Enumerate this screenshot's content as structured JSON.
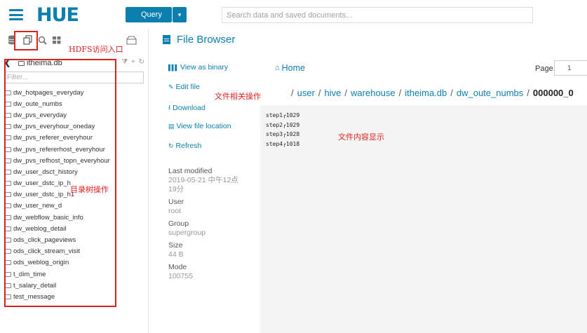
{
  "topbar": {
    "logo": "HUE",
    "query_label": "Query",
    "query_caret": "▾",
    "search_placeholder": "Search data and saved documents..."
  },
  "sidebar": {
    "annotation": "HDFS访问入口",
    "db_name": "itheima.db",
    "filter_placeholder": "Filter...",
    "tree_annotation": "目录树操作",
    "items": [
      "dw_hotpages_everyday",
      "dw_oute_numbs",
      "dw_pvs_everyday",
      "dw_pvs_everyhour_oneday",
      "dw_pvs_referer_everyhour",
      "dw_pvs_refererhost_everyhour",
      "dw_pvs_refhost_topn_everyhour",
      "dw_user_dsct_history",
      "dw_user_dstc_ip_h",
      "dw_user_dstc_ip_h1",
      "dw_user_new_d",
      "dw_webflow_basic_info",
      "dw_weblog_detail",
      "ods_click_pageviews",
      "ods_click_stream_visit",
      "ods_weblog_origin",
      "t_dim_time",
      "t_salary_detail",
      "test_message"
    ]
  },
  "file_browser": {
    "title": "File Browser",
    "actions": {
      "view_as_binary": "View as binary",
      "edit_file": "Edit file",
      "download": "Download",
      "view_file_location": "View file location",
      "refresh": "Refresh"
    },
    "actions_annotation": "文件相关操作",
    "meta": {
      "last_modified_label": "Last modified",
      "last_modified_value": "2019-05-21 中午12点19分",
      "user_label": "User",
      "user_value": "root",
      "group_label": "Group",
      "group_value": "supergroup",
      "size_label": "Size",
      "size_value": "44 B",
      "mode_label": "Mode",
      "mode_value": "100755"
    },
    "home_label": "Home",
    "page_label": "Page",
    "page_value": "1",
    "breadcrumb": [
      "user",
      "hive",
      "warehouse",
      "itheima.db",
      "dw_oute_numbs"
    ],
    "breadcrumb_last": "000000_0",
    "content_lines": [
      "step1\u00011029",
      "step2\u00011029",
      "step3\u00011028",
      "step4\u00011018"
    ],
    "content_annotation": "文件内容显示"
  }
}
